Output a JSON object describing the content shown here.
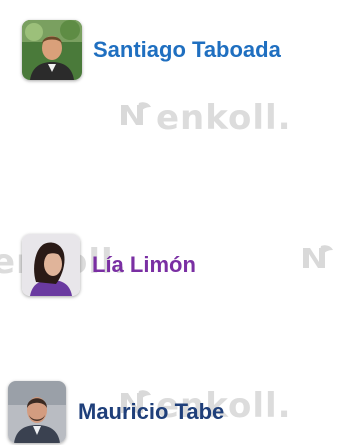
{
  "watermark": {
    "text": "enkoll."
  },
  "candidates": [
    {
      "name": "Santiago Taboada",
      "color": "#1f6fc0"
    },
    {
      "name": "Lía Limón",
      "color": "#7a2fa3"
    },
    {
      "name": "Mauricio Tabe",
      "color": "#1f3f7a"
    }
  ]
}
